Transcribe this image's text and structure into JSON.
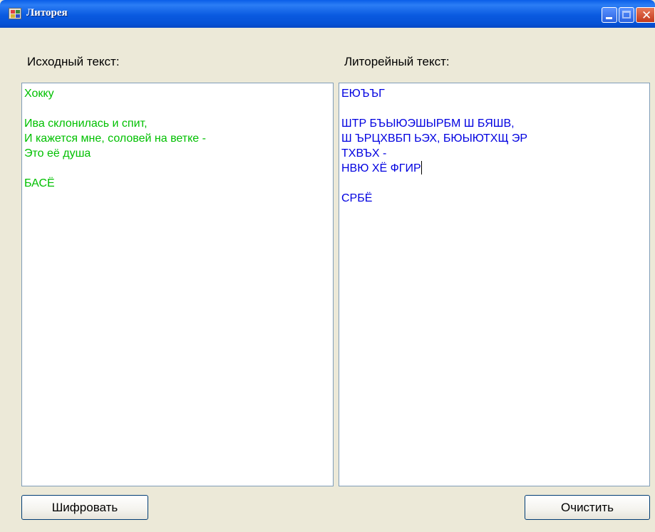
{
  "window": {
    "title": "Литорея",
    "icon": "app-window-icon",
    "controls": [
      "minimize-icon",
      "maximize-icon",
      "close-icon"
    ]
  },
  "source": {
    "label": "Исходный текст:",
    "text": "Хокку\n\nИва склонилась и спит,\nИ кажется мне, соловей на ветке -\nЭто её душа\n\nБАСЁ",
    "color": "#00c000"
  },
  "result": {
    "label": "Литорейный текст:",
    "text_before_caret": "ЕЮЪЪГ\n\nШТР БЪЫЮЭШЫРБМ Ш БЯШВ,\nШ ЪРЦХВБП ЬЭХ, БЮЫЮТХЩ ЭР\nТХВЪХ -\nНВЮ ХЁ ФГИР",
    "text_after_caret": "\n\nСРБЁ",
    "color": "#0000e0"
  },
  "buttons": {
    "encrypt": "Шифровать",
    "clear": "Очистить"
  }
}
